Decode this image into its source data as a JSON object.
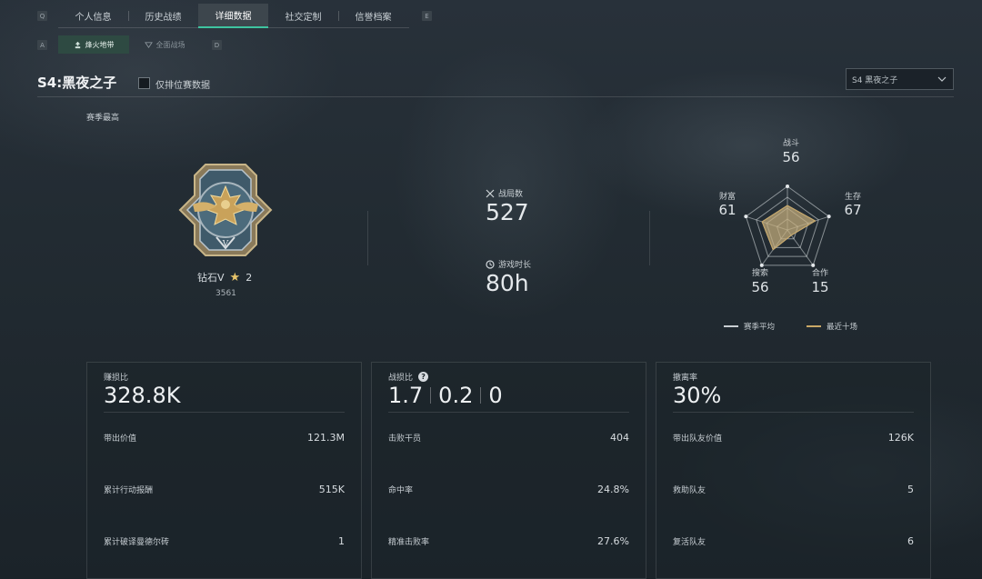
{
  "nav": {
    "key_left": "Q",
    "key_right": "E",
    "tabs": [
      {
        "label": "个人信息",
        "active": false
      },
      {
        "label": "历史战绩",
        "active": false
      },
      {
        "label": "详细数据",
        "active": true
      },
      {
        "label": "社交定制",
        "active": false
      },
      {
        "label": "信誉档案",
        "active": false
      }
    ]
  },
  "subnav": {
    "key_left": "A",
    "key_right": "D",
    "modes": [
      {
        "label": "烽火地带",
        "icon": "mode-extraction-icon",
        "active": true
      },
      {
        "label": "全面战场",
        "icon": "mode-warfare-icon",
        "active": false
      }
    ]
  },
  "header": {
    "season_title": "S4:黑夜之子",
    "ranked_only_label": "仅排位赛数据",
    "ranked_only_checked": false,
    "season_select": "S4 黑夜之子"
  },
  "rank": {
    "section_label": "赛季最高",
    "name": "钻石V",
    "stars": "2",
    "score": "3561"
  },
  "summary": {
    "matches_label": "战局数",
    "matches_value": "527",
    "playtime_label": "游戏时长",
    "playtime_value": "80h"
  },
  "radar": {
    "axes": [
      {
        "label": "战斗",
        "value": "56"
      },
      {
        "label": "生存",
        "value": "67"
      },
      {
        "label": "合作",
        "value": "15"
      },
      {
        "label": "搜索",
        "value": "56"
      },
      {
        "label": "财富",
        "value": "61"
      }
    ],
    "legend": [
      {
        "label": "赛季平均",
        "color": "#c9cfd3"
      },
      {
        "label": "最近十场",
        "color": "#c9a866"
      }
    ]
  },
  "cards": [
    {
      "label": "赚损比",
      "values": [
        "328.8K"
      ],
      "help": false,
      "rows": [
        {
          "label": "带出价值",
          "value": "121.3M"
        },
        {
          "label": "累计行动报酬",
          "value": "515K"
        },
        {
          "label": "累计破译曼德尔砖",
          "value": "1"
        }
      ]
    },
    {
      "label": "战损比",
      "values": [
        "1.7",
        "0.2",
        "0"
      ],
      "help": true,
      "help_text": "?",
      "rows": [
        {
          "label": "击败干员",
          "value": "404"
        },
        {
          "label": "命中率",
          "value": "24.8%"
        },
        {
          "label": "精准击败率",
          "value": "27.6%"
        }
      ]
    },
    {
      "label": "撤离率",
      "values": [
        "30%"
      ],
      "help": false,
      "rows": [
        {
          "label": "带出队友价值",
          "value": "126K"
        },
        {
          "label": "救助队友",
          "value": "5"
        },
        {
          "label": "复活队友",
          "value": "6"
        }
      ]
    }
  ]
}
